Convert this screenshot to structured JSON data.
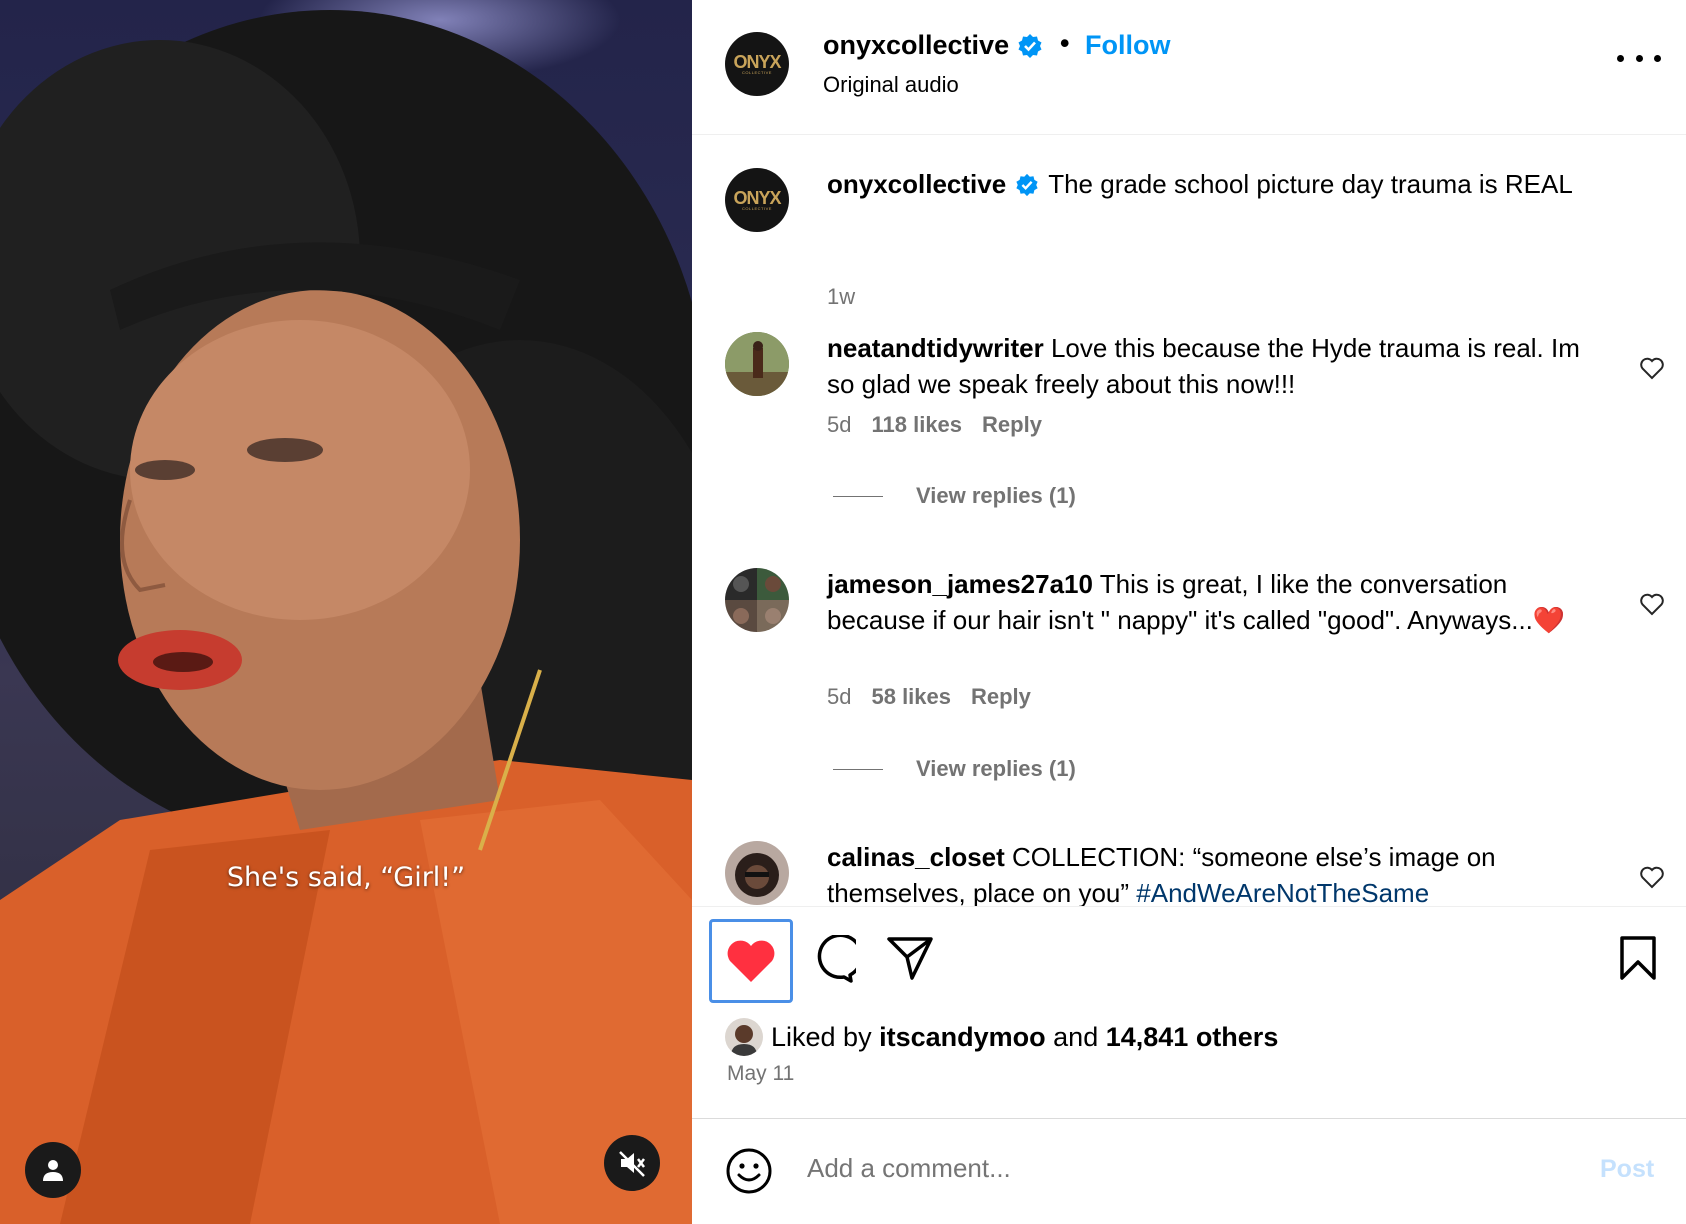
{
  "video": {
    "caption": "She's said, “Girl!”",
    "profile_icon": "user-icon",
    "mute_icon": "speaker-muted-icon"
  },
  "header": {
    "username": "onyxcollective",
    "verified_icon": "verified-badge-icon",
    "separator": "•",
    "follow_label": "Follow",
    "audio": "Original audio",
    "avatar_logo": "ONYX",
    "avatar_logo_sub": "COLLECTIVE",
    "more_icon": "more-options-icon"
  },
  "caption_post": {
    "username": "onyxcollective",
    "text": "The grade school picture day trauma is REAL",
    "time": "1w"
  },
  "comments": [
    {
      "username": "neatandtidywriter",
      "text": "Love this because the Hyde trauma is real. Im so glad we speak freely about this now!!!",
      "time": "5d",
      "likes": "118 likes",
      "reply_label": "Reply",
      "view_replies": "View replies (1)"
    },
    {
      "username": "jameson_james27a10",
      "text": "This is great, I like the conversation because if our hair isn't \" nappy\" it's called \"good\". Anyways...❤️",
      "time": "5d",
      "likes": "58 likes",
      "reply_label": "Reply",
      "view_replies": "View replies (1)"
    },
    {
      "username": "calinas_closet",
      "text": "COLLECTION: “someone else’s image on themselves, place on you”",
      "hashtag": "#AndWeAreNotTheSame"
    }
  ],
  "actions": {
    "like_icon": "heart-filled-icon",
    "comment_icon": "comment-icon",
    "share_icon": "share-icon",
    "save_icon": "bookmark-icon",
    "liked_by_prefix": "Liked by",
    "liked_by_user": "itscandymoo",
    "liked_by_and": "and",
    "liked_by_others": "14,841 others",
    "date": "May 11",
    "like_color": "#ff3040"
  },
  "add_comment": {
    "emoji_icon": "emoji-icon",
    "placeholder": "Add a comment...",
    "post_label": "Post"
  },
  "colors": {
    "accent": "#0095f6",
    "muted_text": "#737373",
    "hashtag": "#00376b",
    "post_disabled": "#c5e1fd"
  }
}
